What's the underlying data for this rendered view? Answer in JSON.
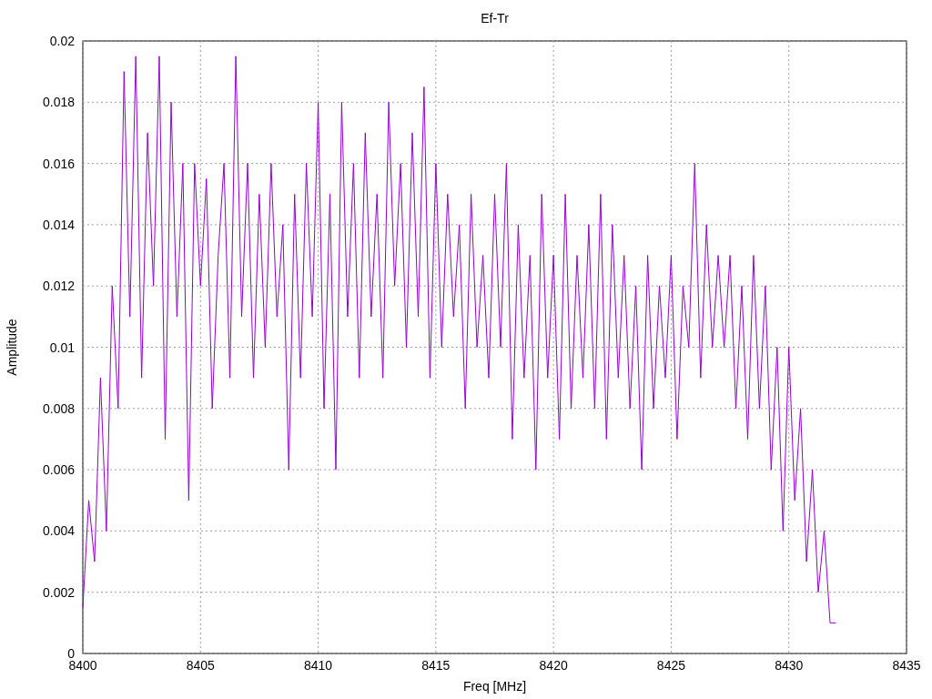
{
  "chart_data": {
    "type": "line",
    "title": "Ef-Tr",
    "xlabel": "Freq [MHz]",
    "ylabel": "Amplitude",
    "grid": true,
    "xlim": [
      8400,
      8435
    ],
    "ylim": [
      0,
      0.02
    ],
    "xticks": [
      8400,
      8405,
      8410,
      8415,
      8420,
      8425,
      8430,
      8435
    ],
    "yticks": [
      {
        "value": 0,
        "label": "0"
      },
      {
        "value": 0.002,
        "label": "0.002"
      },
      {
        "value": 0.004,
        "label": "0.004"
      },
      {
        "value": 0.006,
        "label": "0.006"
      },
      {
        "value": 0.008,
        "label": "0.008"
      },
      {
        "value": 0.01,
        "label": "0.01"
      },
      {
        "value": 0.012,
        "label": "0.012"
      },
      {
        "value": 0.014,
        "label": "0.014"
      },
      {
        "value": 0.016,
        "label": "0.016"
      },
      {
        "value": 0.018,
        "label": "0.018"
      },
      {
        "value": 0.02,
        "label": "0.02"
      }
    ],
    "x": [
      8400,
      8400.25,
      8400.5,
      8400.75,
      8401,
      8401.25,
      8401.5,
      8401.75,
      8402,
      8402.25,
      8402.5,
      8402.75,
      8403,
      8403.25,
      8403.5,
      8403.75,
      8404,
      8404.25,
      8404.5,
      8404.75,
      8405,
      8405.25,
      8405.5,
      8405.75,
      8406,
      8406.25,
      8406.5,
      8406.75,
      8407,
      8407.25,
      8407.5,
      8407.75,
      8408,
      8408.25,
      8408.5,
      8408.75,
      8409,
      8409.25,
      8409.5,
      8409.75,
      8410,
      8410.25,
      8410.5,
      8410.75,
      8411,
      8411.25,
      8411.5,
      8411.75,
      8412,
      8412.25,
      8412.5,
      8412.75,
      8413,
      8413.25,
      8413.5,
      8413.75,
      8414,
      8414.25,
      8414.5,
      8414.75,
      8415,
      8415.25,
      8415.5,
      8415.75,
      8416,
      8416.25,
      8416.5,
      8416.75,
      8417,
      8417.25,
      8417.5,
      8417.75,
      8418,
      8418.25,
      8418.5,
      8418.75,
      8419,
      8419.25,
      8419.5,
      8419.75,
      8420,
      8420.25,
      8420.5,
      8420.75,
      8421,
      8421.25,
      8421.5,
      8421.75,
      8422,
      8422.25,
      8422.5,
      8422.75,
      8423,
      8423.25,
      8423.5,
      8423.75,
      8424,
      8424.25,
      8424.5,
      8424.75,
      8425,
      8425.25,
      8425.5,
      8425.75,
      8426,
      8426.25,
      8426.5,
      8426.75,
      8427,
      8427.25,
      8427.5,
      8427.75,
      8428,
      8428.25,
      8428.5,
      8428.75,
      8429,
      8429.25,
      8429.5,
      8429.75,
      8430,
      8430.25,
      8430.5,
      8430.75,
      8431,
      8431.25,
      8431.5,
      8431.75,
      8432
    ],
    "series": [
      {
        "color": "#9400d3",
        "values": [
          0.0015,
          0.005,
          0.003,
          0.009,
          0.004,
          0.012,
          0.008,
          0.019,
          0.011,
          0.0195,
          0.009,
          0.017,
          0.012,
          0.0195,
          0.007,
          0.018,
          0.011,
          0.016,
          0.005,
          0.016,
          0.012,
          0.0155,
          0.008,
          0.013,
          0.016,
          0.009,
          0.0195,
          0.011,
          0.016,
          0.009,
          0.015,
          0.01,
          0.016,
          0.011,
          0.014,
          0.006,
          0.015,
          0.009,
          0.016,
          0.011,
          0.018,
          0.008,
          0.015,
          0.006,
          0.018,
          0.011,
          0.016,
          0.009,
          0.017,
          0.011,
          0.015,
          0.009,
          0.018,
          0.012,
          0.016,
          0.01,
          0.017,
          0.011,
          0.0185,
          0.009,
          0.016,
          0.01,
          0.015,
          0.011,
          0.014,
          0.008,
          0.015,
          0.01,
          0.013,
          0.009,
          0.015,
          0.01,
          0.016,
          0.007,
          0.014,
          0.009,
          0.013,
          0.006,
          0.015,
          0.009,
          0.013,
          0.007,
          0.015,
          0.008,
          0.013,
          0.009,
          0.014,
          0.008,
          0.015,
          0.007,
          0.014,
          0.009,
          0.013,
          0.008,
          0.012,
          0.006,
          0.013,
          0.008,
          0.012,
          0.009,
          0.013,
          0.007,
          0.012,
          0.01,
          0.016,
          0.009,
          0.014,
          0.01,
          0.013,
          0.01,
          0.013,
          0.008,
          0.012,
          0.007,
          0.013,
          0.008,
          0.012,
          0.006,
          0.01,
          0.004,
          0.01,
          0.005,
          0.008,
          0.003,
          0.006,
          0.002,
          0.004,
          0.001,
          0.001
        ]
      }
    ]
  }
}
